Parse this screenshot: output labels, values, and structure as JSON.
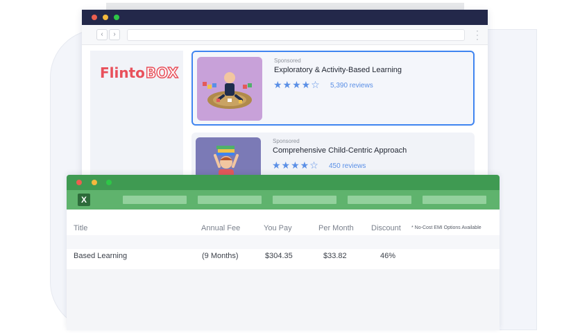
{
  "browser": {
    "nav": {
      "back_icon": "chevron-left-icon",
      "forward_icon": "chevron-right-icon",
      "back_glyph": "‹",
      "forward_glyph": "›"
    },
    "menu_icon": "vertical-dots-icon"
  },
  "brand": {
    "logo_part1": "Flinto",
    "logo_part2": "BOX",
    "color": "#e8505b"
  },
  "ads": [
    {
      "sponsored": "Sponsored",
      "title": "Exploratory & Activity-Based Learning",
      "stars": "★★★★☆",
      "rating": 4,
      "reviews": "5,390 reviews",
      "selected": true
    },
    {
      "sponsored": "Sponsored",
      "title": "Comprehensive Child-Centric Approach",
      "stars": "★★★★☆",
      "rating": 4,
      "reviews": "450 reviews",
      "selected": false
    }
  ],
  "sheet": {
    "app_icon_letter": "X",
    "columns": {
      "title": "Title",
      "annual_fee": "Annual Fee",
      "you_pay": "You Pay",
      "per_month": "Per Month",
      "discount": "Discount"
    },
    "note": "* No-Cost EMI Options Available",
    "row": {
      "title": "Based Learning",
      "annual_fee": "(9 Months)",
      "you_pay": "$304.35",
      "per_month": "$33.82",
      "discount": "46%"
    }
  },
  "colors": {
    "accent_blue": "#3f84f0",
    "excel_green": "#3f9a52",
    "star_blue": "#5a8fe6"
  }
}
